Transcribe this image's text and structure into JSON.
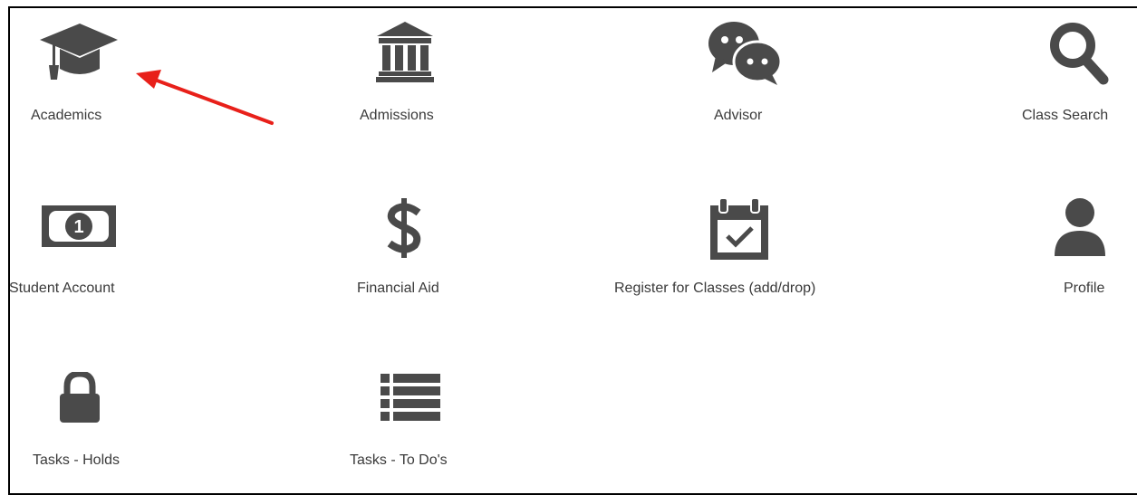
{
  "colors": {
    "icon": "#4a4a4a",
    "label": "#3a3a3a",
    "arrow": "#e8201a",
    "border": "#000000"
  },
  "tiles": [
    {
      "label": "Academics",
      "icon": "graduation-cap-icon"
    },
    {
      "label": "Admissions",
      "icon": "bank-building-icon"
    },
    {
      "label": "Advisor",
      "icon": "chat-bubbles-icon"
    },
    {
      "label": "Class Search",
      "icon": "search-icon"
    },
    {
      "label": "Student Account",
      "icon": "money-bill-icon"
    },
    {
      "label": "Financial Aid",
      "icon": "dollar-sign-icon"
    },
    {
      "label": "Register for Classes (add/drop)",
      "icon": "calendar-check-icon"
    },
    {
      "label": "Profile",
      "icon": "user-icon"
    },
    {
      "label": "Tasks - Holds",
      "icon": "lock-icon"
    },
    {
      "label": "Tasks - To Do's",
      "icon": "list-icon"
    }
  ]
}
